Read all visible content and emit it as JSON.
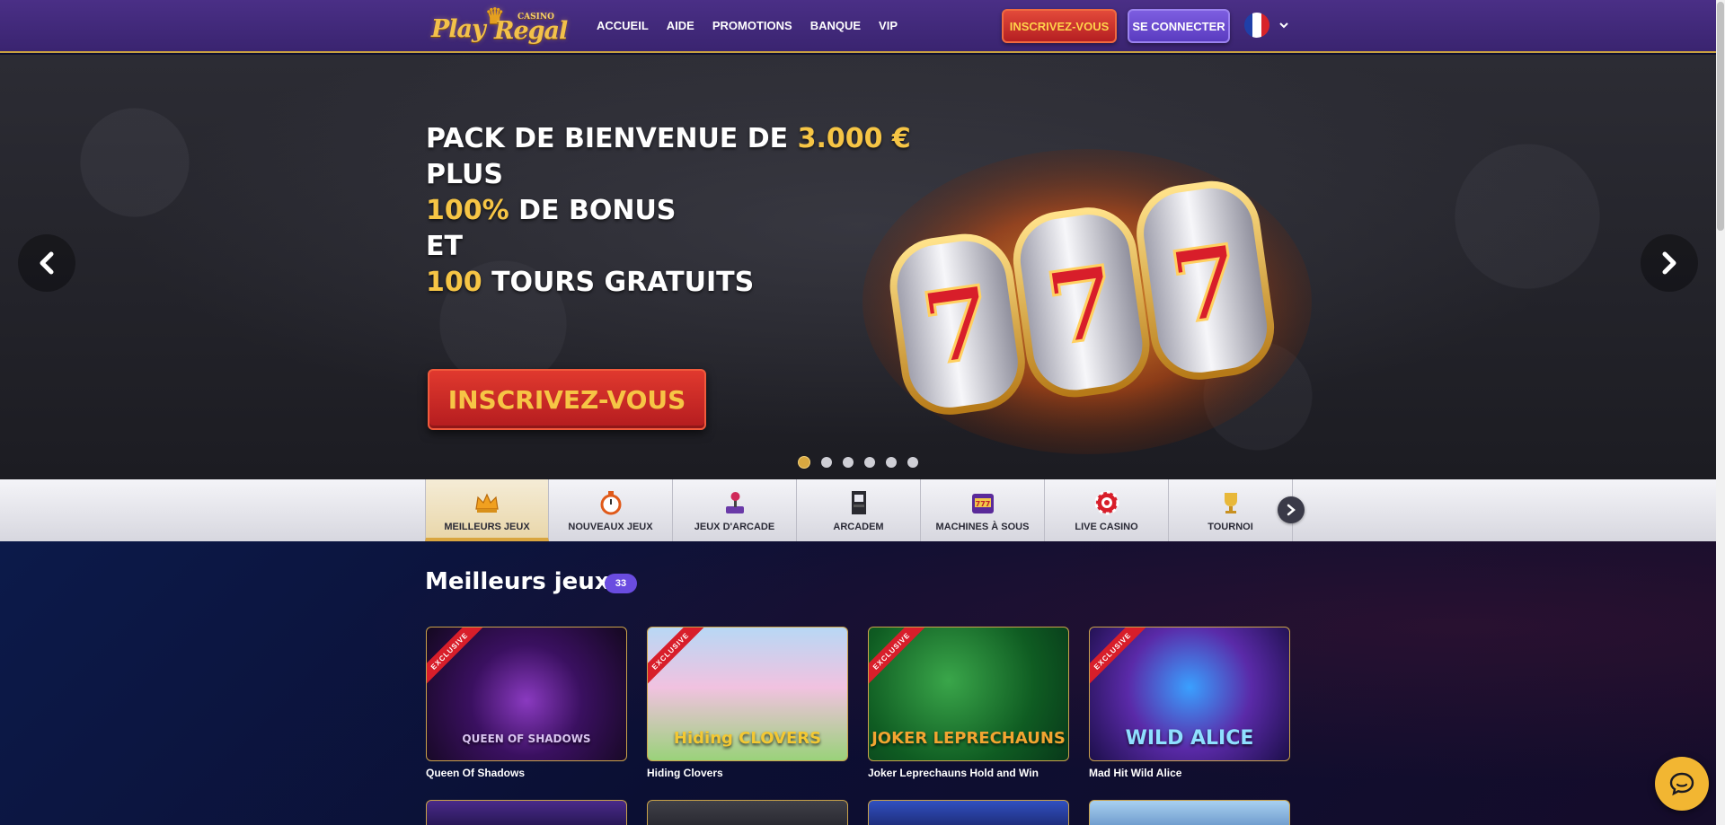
{
  "brand": {
    "logo_word1": "Play",
    "logo_word2": "Regal",
    "logo_casino": "CASINO"
  },
  "nav": [
    {
      "label": "ACCUEIL"
    },
    {
      "label": "AIDE"
    },
    {
      "label": "PROMOTIONS"
    },
    {
      "label": "BANQUE"
    },
    {
      "label": "VIP"
    }
  ],
  "header": {
    "register_label": "INSCRIVEZ-VOUS",
    "login_label": "SE CONNECTER",
    "language_flag": "france-flag-icon"
  },
  "hero": {
    "line1_a": "PACK DE BIENVENUE DE ",
    "line1_b": "3.000 €",
    "line2": "PLUS",
    "line3_a": "100%",
    "line3_b": " DE BONUS",
    "line4": "ET",
    "line5_a": "100",
    "line5_b": " TOURS GRATUITS",
    "cta_label": "INSCRIVEZ-VOUS",
    "slot_symbols": [
      "7",
      "7",
      "7"
    ],
    "slide_count": 6,
    "active_slide": 1
  },
  "categories": [
    {
      "label": "MEILLEURS JEUX",
      "icon": "crown-icon",
      "active": true
    },
    {
      "label": "NOUVEAUX JEUX",
      "icon": "stopwatch-icon"
    },
    {
      "label": "JEUX D'ARCADE",
      "icon": "joystick-icon"
    },
    {
      "label": "ARCADEM",
      "icon": "arcade-cabinet-icon"
    },
    {
      "label": "MACHINES À SOUS",
      "icon": "slot-machine-icon"
    },
    {
      "label": "LIVE CASINO",
      "icon": "casino-chip-icon"
    },
    {
      "label": "TOURNOI",
      "icon": "trophy-icon"
    }
  ],
  "section": {
    "title": "Meilleurs jeux",
    "count": "33"
  },
  "games": [
    {
      "name": "Queen Of Shadows",
      "art_text": "QUEEN OF SHADOWS",
      "ribbon": "EXCLUSIVE",
      "art_color": "#d9c4f0"
    },
    {
      "name": "Hiding Clovers",
      "art_text": "Hiding CLOVERS",
      "ribbon": "EXCLUSIVE",
      "art_color": "#f3c833"
    },
    {
      "name": "Joker Leprechauns Hold and Win",
      "art_text": "JOKER LEPRECHAUNS",
      "ribbon": "EXCLUSIVE",
      "art_color": "#f2a531"
    },
    {
      "name": "Mad Hit Wild Alice",
      "art_text": "WILD ALICE",
      "ribbon": "EXCLUSIVE",
      "art_color": "#8fe0ff"
    }
  ],
  "colors": {
    "gold": "#f6c545",
    "header_purple": "#3a2470",
    "register_red": "#c8282a",
    "login_purple": "#6a4ce0",
    "chat_yellow": "#f2b632"
  }
}
